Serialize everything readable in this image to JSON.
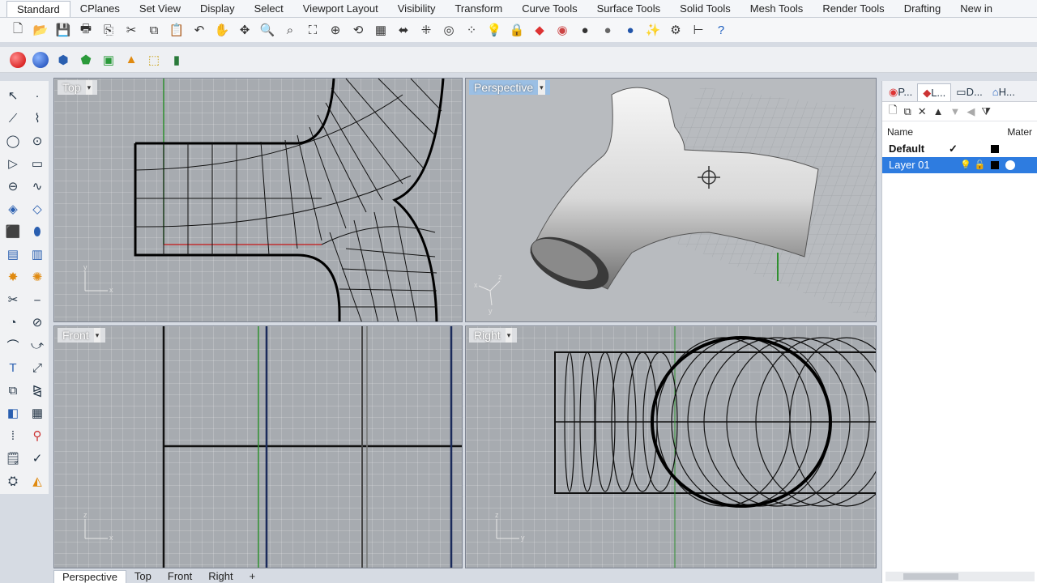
{
  "menu_tabs": [
    "Standard",
    "CPlanes",
    "Set View",
    "Display",
    "Select",
    "Viewport Layout",
    "Visibility",
    "Transform",
    "Curve Tools",
    "Surface Tools",
    "Solid Tools",
    "Mesh Tools",
    "Render Tools",
    "Drafting",
    "New in"
  ],
  "active_menu_tab": "Standard",
  "viewports": {
    "top": {
      "label": "Top",
      "axes": [
        "y",
        "x"
      ]
    },
    "perspective": {
      "label": "Perspective",
      "axes": [
        "z",
        "x",
        "y"
      ]
    },
    "front": {
      "label": "Front",
      "axes": [
        "z",
        "x"
      ]
    },
    "right": {
      "label": "Right",
      "axes": [
        "z",
        "y"
      ]
    }
  },
  "viewport_tabs": [
    "Perspective",
    "Top",
    "Front",
    "Right"
  ],
  "active_viewport_tab": "Perspective",
  "panel": {
    "tabs": [
      "P...",
      "L...",
      "D...",
      "H..."
    ],
    "columns": {
      "name": "Name",
      "material": "Mater"
    },
    "layers": [
      {
        "name": "Default",
        "current": "✓",
        "color": "#000000"
      },
      {
        "name": "Layer 01",
        "color": "#000000",
        "selected": true
      }
    ]
  },
  "colors": {
    "accent": "#2e7ce0",
    "viewport_bg": "#a7abb0",
    "active_vp_label": "#9bbfe4"
  }
}
